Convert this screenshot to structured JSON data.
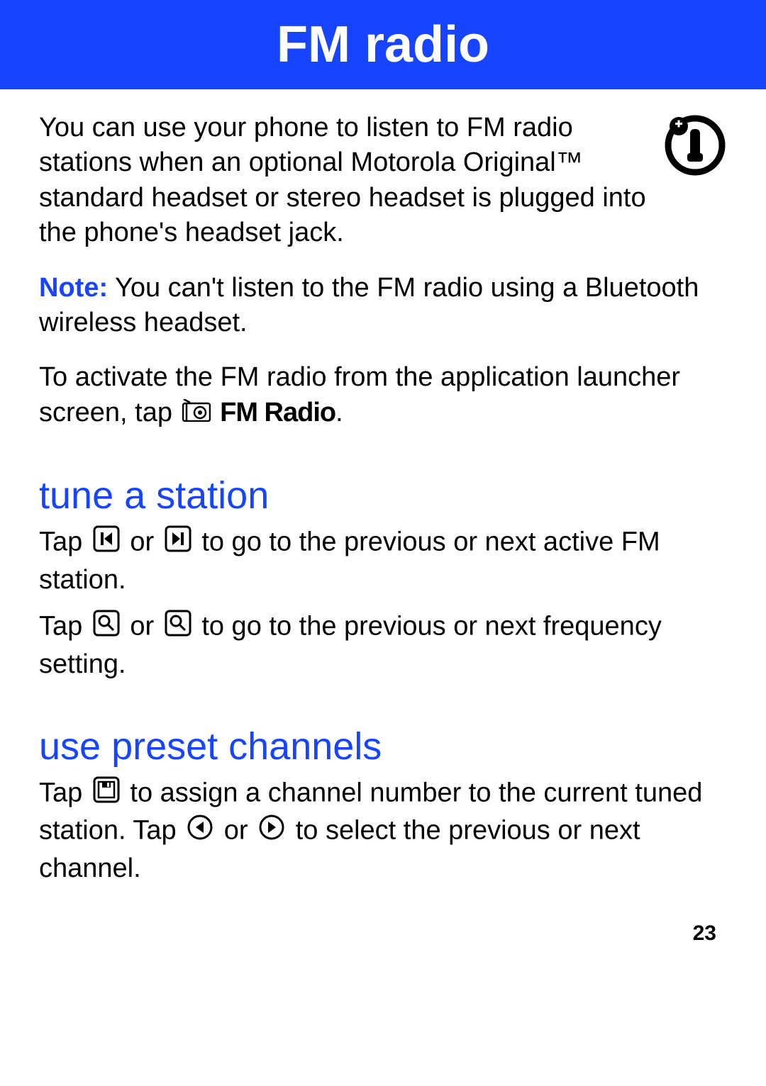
{
  "header": {
    "title": "FM radio"
  },
  "intro": {
    "text": "You can use your phone to listen to FM radio stations when an optional Motorola Original™ standard headset or stereo headset is plugged into the phone's headset jack."
  },
  "note": {
    "label": "Note:",
    "text": " You can't listen to the FM radio using a Bluetooth wireless headset."
  },
  "activate": {
    "prefix": "To activate the FM radio from the application launcher screen, tap ",
    "fm_label": "FM Radio",
    "suffix": "."
  },
  "tune": {
    "heading": "tune a station",
    "p1_prefix": "Tap ",
    "p1_mid": " or ",
    "p1_suffix": " to go to the previous or next active FM station.",
    "p2_prefix": "Tap ",
    "p2_mid": " or ",
    "p2_suffix": " to go to the previous or next frequency setting."
  },
  "preset": {
    "heading": "use preset channels",
    "p_prefix": "Tap ",
    "p_mid1": " to assign a channel number to the current tuned station. Tap ",
    "p_mid2": " or ",
    "p_suffix": " to select the previous or next channel."
  },
  "page_number": "23"
}
